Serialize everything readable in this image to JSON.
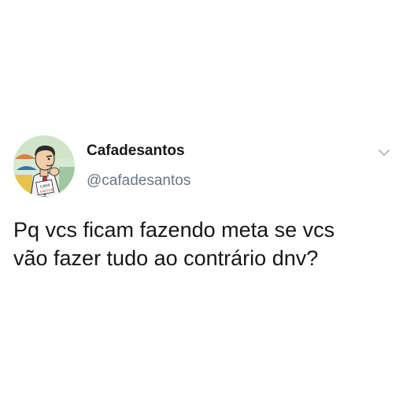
{
  "tweet": {
    "author": {
      "display_name": "Cafadesantos",
      "handle": "@cafadesantos",
      "avatar_icon": "cartoon-man-portrait-icon"
    },
    "text_lines": [
      "Pq vcs ficam fazendo meta se vcs",
      "vão fazer tudo ao contrário dnv?"
    ],
    "menu_icon": "chevron-down-icon"
  },
  "colors": {
    "background": "#ffffff",
    "text_primary": "#14171a",
    "text_secondary": "#657786",
    "chevron": "#aab8c2"
  }
}
